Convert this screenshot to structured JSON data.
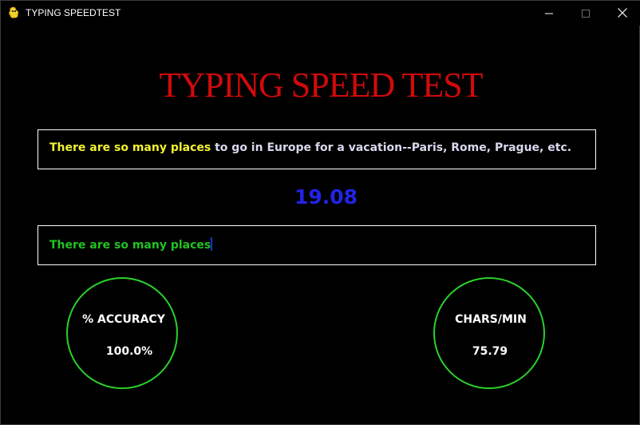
{
  "window": {
    "title": "TYPING SPEEDTEST",
    "icons": {
      "app": "pygame-snake-icon",
      "minimize": "minimize-icon",
      "maximize": "maximize-icon",
      "close": "close-icon"
    }
  },
  "heading": "TYPING SPEED TEST",
  "prompt": {
    "typed": "There are so many places",
    "rest": " to go in Europe for a vacation--Paris, Rome, Prague, etc."
  },
  "timer": "19.08",
  "input": {
    "value": "There are so many places"
  },
  "stats": {
    "accuracy": {
      "label": "% ACCURACY",
      "value": "100.0%"
    },
    "cpm": {
      "label": "CHARS/MIN",
      "value": "75.79"
    }
  },
  "colors": {
    "heading": "#d10a0a",
    "typed_prompt": "#f2f231",
    "remaining_prompt": "#d8d8ee",
    "input_text": "#22c322",
    "timer": "#2323e8",
    "circle": "#2ad12a",
    "cursor": "#1c2cd8"
  }
}
